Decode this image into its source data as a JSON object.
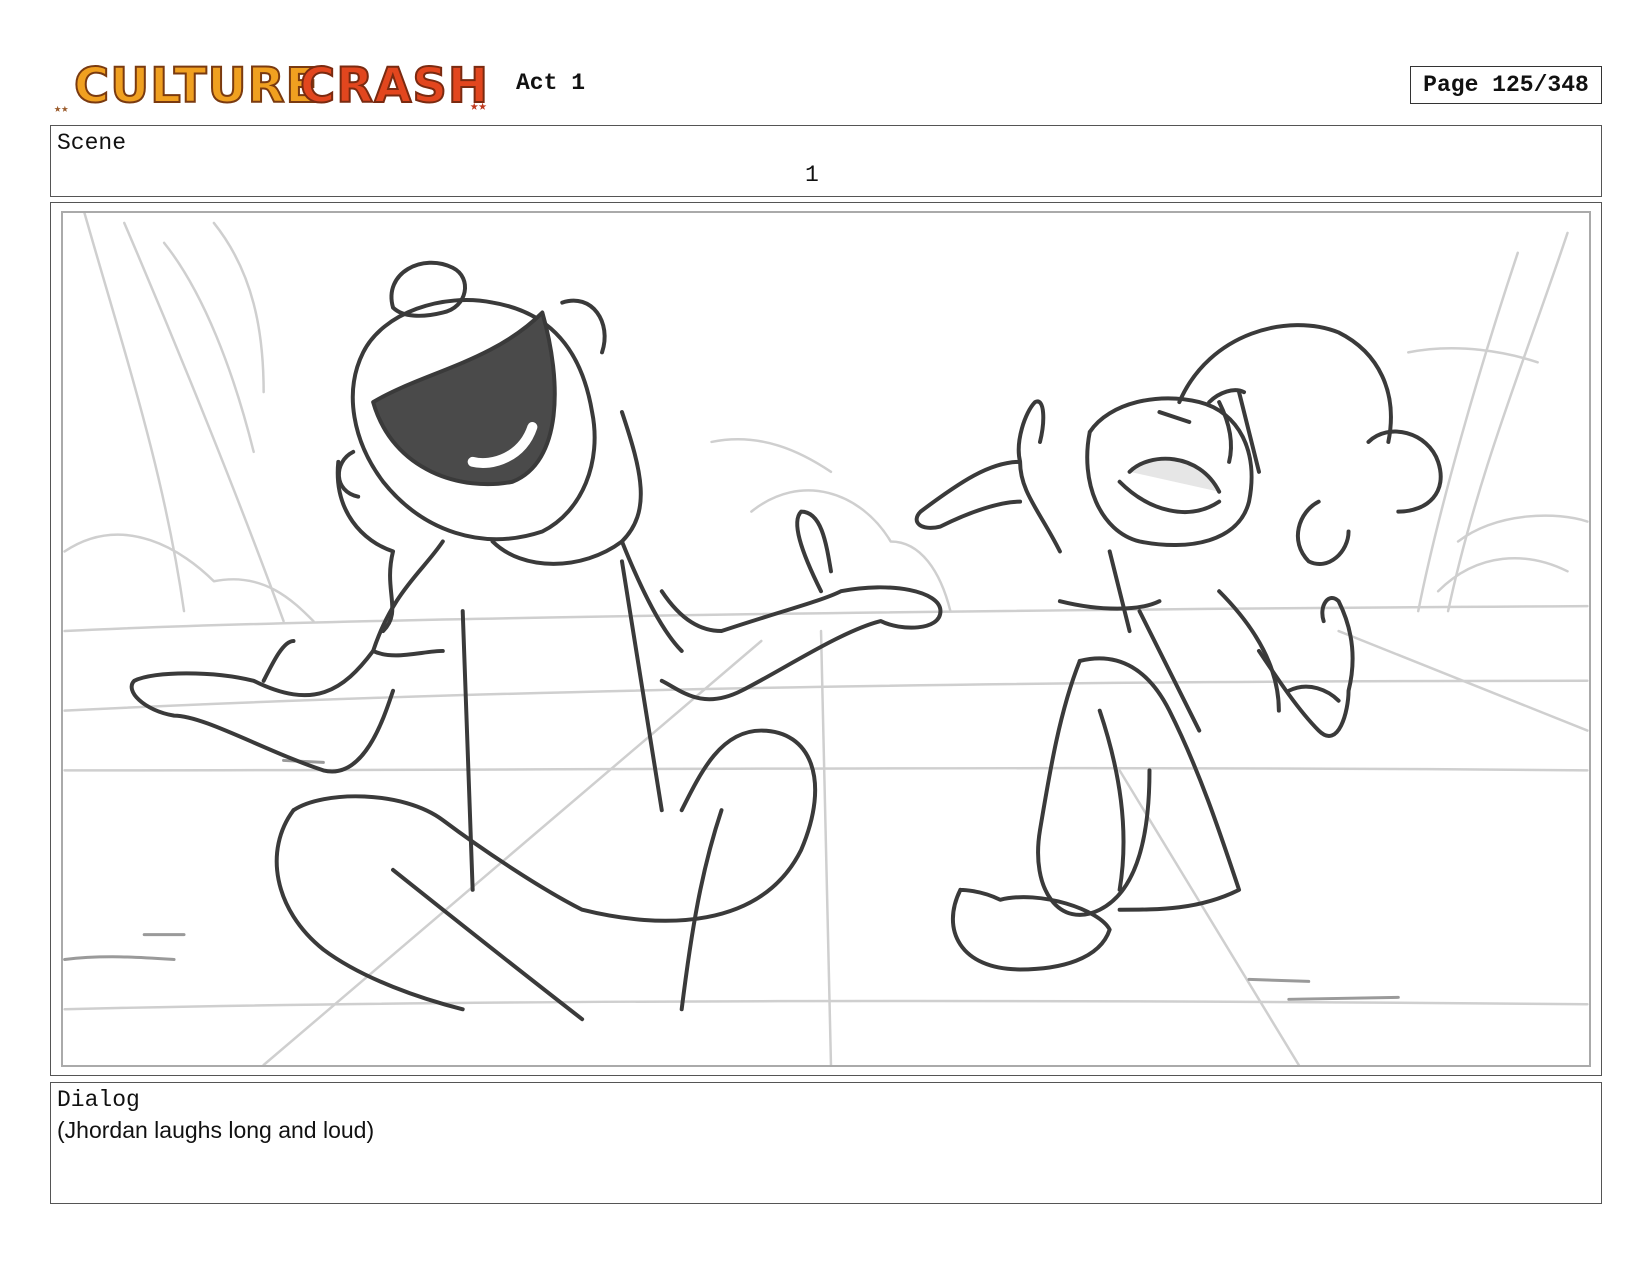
{
  "header": {
    "logo_text": "CULTURE CRASH",
    "act_label": "Act 1",
    "page_label": "Page 125/348"
  },
  "scene": {
    "label": "Scene",
    "number": "1"
  },
  "panel": {
    "image_name": "storyboard-sketch"
  },
  "dialog": {
    "label": "Dialog",
    "text": "(Jhordan laughs long and loud)"
  },
  "colors": {
    "logo_orange": "#f0a020",
    "logo_red": "#e2461e",
    "logo_outline": "#7a3a10",
    "sketch_dark": "#3a3a3a",
    "sketch_light": "#c8c8c8"
  }
}
